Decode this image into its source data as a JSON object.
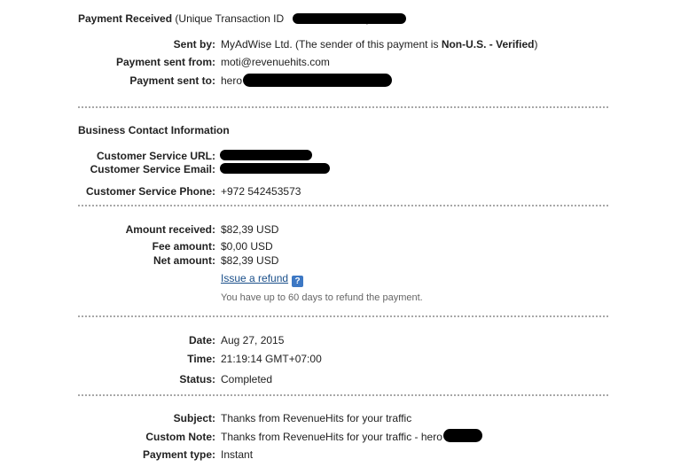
{
  "header": {
    "title": "Payment Received",
    "txn_prefix": "(Unique Transaction ID",
    "txn_suffix": ")"
  },
  "payment": {
    "sent_by_label": "Sent by:",
    "sent_by_name": "MyAdWise Ltd.",
    "sent_by_note_prefix": "(The sender of this payment is",
    "sent_by_status": "Non-U.S. - Verified",
    "sent_by_note_suffix": ")",
    "from_label": "Payment sent from:",
    "from_value": "moti@revenuehits.com",
    "to_label": "Payment sent to:",
    "to_value_prefix": "hero"
  },
  "business": {
    "section_title": "Business Contact Information",
    "url_label": "Customer Service URL:",
    "email_label": "Customer Service Email:",
    "phone_label": "Customer Service Phone:",
    "phone_value": "+972 542453573"
  },
  "amounts": {
    "received_label": "Amount received:",
    "received_value": "$82,39 USD",
    "fee_label": "Fee amount:",
    "fee_value": "$0,00 USD",
    "net_label": "Net amount:",
    "net_value": "$82,39 USD",
    "refund_link": "Issue a refund",
    "help_icon": "?",
    "refund_note": "You have up to 60 days to refund the payment."
  },
  "details": {
    "date_label": "Date:",
    "date_value": "Aug 27, 2015",
    "time_label": "Time:",
    "time_value": "21:19:14 GMT+07:00",
    "status_label": "Status:",
    "status_value": "Completed"
  },
  "message": {
    "subject_label": "Subject:",
    "subject_value": "Thanks from RevenueHits for your traffic",
    "note_label": "Custom Note:",
    "note_value_prefix": "Thanks from RevenueHits for your traffic - hero",
    "type_label": "Payment type:",
    "type_value": "Instant"
  },
  "colors": {
    "separator": "#a8a8a8",
    "link": "#1a4f8a",
    "help_icon_bg": "#3d78c4",
    "redaction": "#000000"
  }
}
